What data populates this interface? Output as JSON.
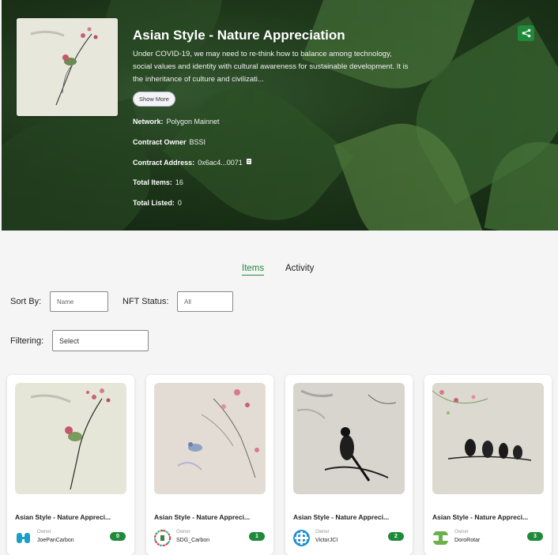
{
  "collection": {
    "title": "Asian Style - Nature Appreciation",
    "description": "Under COVID-19, we may need to re-think how to balance among technology, social values and identity with cultural awareness for sustainable development. It is the inheritance of culture and civilizati...",
    "show_more_label": "Show More",
    "network_label": "Network:",
    "network_value": "Polygon Mainnet",
    "owner_label": "Contract Owner",
    "owner_value": "BSSI",
    "address_label": "Contract Address:",
    "address_value": "0x6ac4...0071",
    "total_items_label": "Total Items:",
    "total_items_value": "16",
    "total_listed_label": "Total Listed:",
    "total_listed_value": "0",
    "share_icon": "share-icon",
    "copy_icon": "copy-icon"
  },
  "tabs": [
    {
      "label": "Items",
      "active": true
    },
    {
      "label": "Activity",
      "active": false
    }
  ],
  "filters": {
    "sort_label": "Sort By:",
    "sort_value": "Name",
    "status_label": "NFT Status:",
    "status_value": "All",
    "filtering_label": "Filtering:",
    "filtering_value": "Select"
  },
  "items": [
    {
      "title": "Asian Style - Nature Appreci...",
      "owner_label": "Owner",
      "owner_name": "JoePanCarbon",
      "index": "0"
    },
    {
      "title": "Asian Style - Nature Appreci...",
      "owner_label": "Owner",
      "owner_name": "SDG_Carbon",
      "index": "1"
    },
    {
      "title": "Asian Style - Nature Appreci...",
      "owner_label": "Owner",
      "owner_name": "VictorJCI",
      "index": "2"
    },
    {
      "title": "Asian Style - Nature Appreci...",
      "owner_label": "Owner",
      "owner_name": "DoroRotar",
      "index": "3"
    }
  ],
  "colors": {
    "accent": "#1f8a3a",
    "page_bg": "#f5f5f5",
    "hero_bg": "#24421f"
  }
}
